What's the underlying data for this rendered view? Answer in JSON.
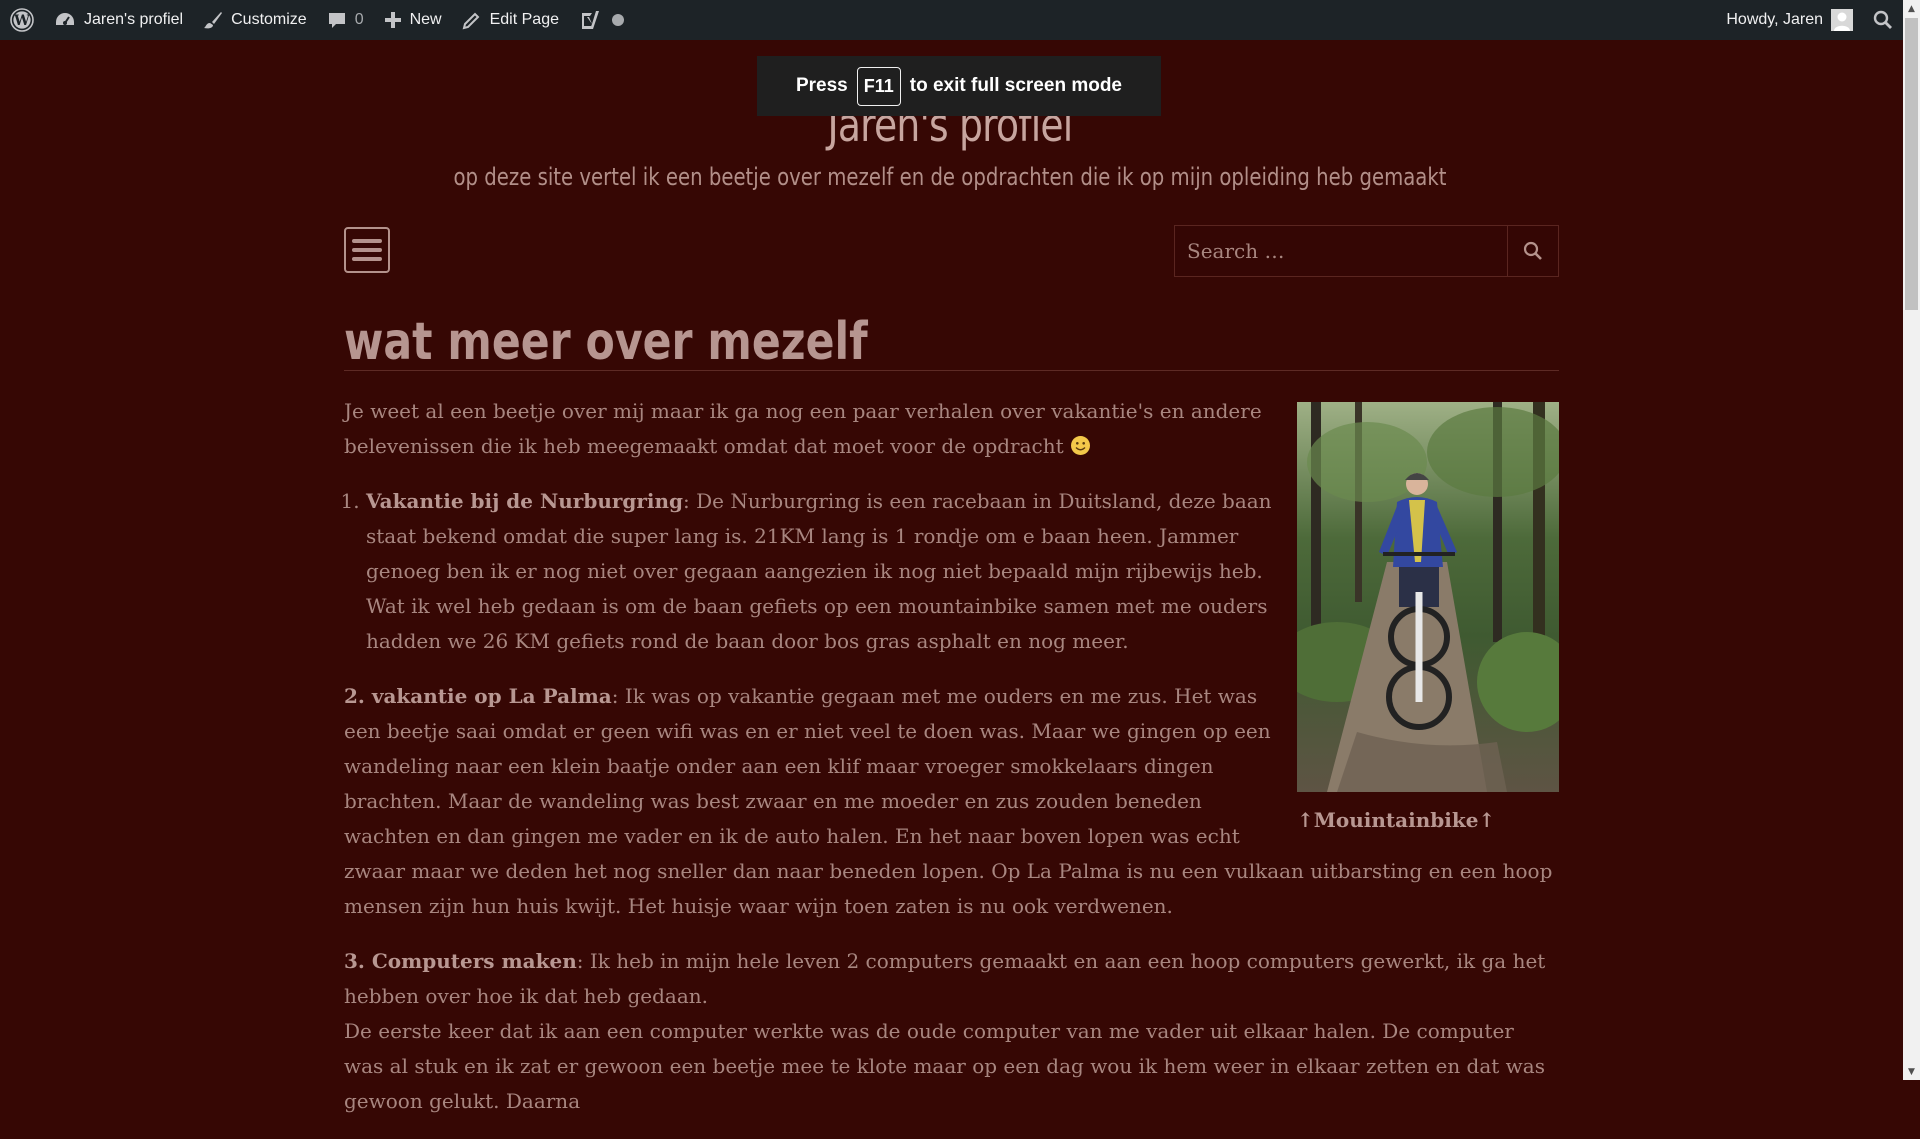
{
  "adminbar": {
    "wp_logo": "wordpress-icon",
    "site_name": "Jaren's profiel",
    "customize": "Customize",
    "comments_count": "0",
    "new_label": "New",
    "edit_page": "Edit Page",
    "howdy": "Howdy, Jaren"
  },
  "fullscreen_notice": {
    "prefix": "Press",
    "key": "F11",
    "suffix": "to exit full screen mode"
  },
  "site": {
    "title": "Jaren's profiel",
    "description": "op deze site vertel ik een beetje over mezelf en de opdrachten die ik op mijn opleiding heb gemaakt"
  },
  "search": {
    "placeholder": "Search …"
  },
  "page": {
    "title": "wat meer over mezelf",
    "intro": "Je weet al een beetje over mij maar ik ga nog een paar verhalen over vakantie's en andere belevenissen die ik heb meegemaakt omdat dat moet voor de opdracht",
    "item1_title": "Vakantie bij de Nurburgring",
    "item1_text": ": De Nurburgring is een racebaan in Duitsland, deze baan staat bekend omdat die super lang is. 21KM lang is 1 rondje om e baan heen. Jammer genoeg ben ik er nog niet over gegaan aangezien ik nog niet bepaald mijn rijbewijs heb. Wat ik wel heb gedaan is om de baan gefiets op een mountainbike samen met me ouders hadden we 26 KM gefiets rond de baan door bos gras asphalt en nog meer.",
    "item2_title": "2. vakantie op La Palma",
    "item2_text": ": Ik was op vakantie gegaan met me ouders en me zus. Het was een beetje saai omdat er geen wifi was en er niet veel te doen was. Maar we gingen op een wandeling naar een klein baatje onder aan een klif maar vroeger smokkelaars dingen brachten. Maar de wandeling was best zwaar en me moeder en zus zouden beneden wachten en dan gingen me vader en ik de auto halen. En het naar boven lopen was echt zwaar maar we deden het nog sneller dan naar beneden lopen. Op La Palma is nu een vulkaan uitbarsting en een hoop mensen zijn hun huis kwijt. Het huisje waar wijn toen zaten is nu ook verdwenen.",
    "item3_title": "3. Computers maken",
    "item3_text": ": Ik heb in mijn hele leven 2 computers gemaakt en aan een hoop computers gewerkt, ik ga het hebben over hoe ik dat heb gedaan.",
    "para4": "De eerste keer dat ik aan een computer werkte was de oude computer van me vader uit elkaar halen. De computer was al stuk en ik zat er gewoon een beetje mee te klote maar op een dag wou ik hem weer in elkaar zetten en dat was gewoon gelukt. Daarna",
    "image_caption": "↑Mouintainbike↑"
  },
  "colors": {
    "background": "#360704",
    "adminbar": "#1d2327",
    "text": "#a88680",
    "title": "#c7a59f"
  }
}
